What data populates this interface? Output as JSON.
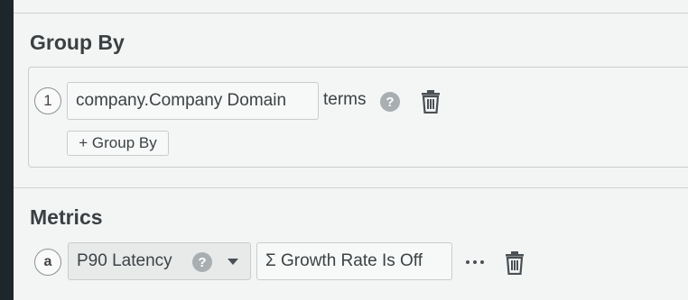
{
  "group_by": {
    "title": "Group By",
    "rows": [
      {
        "index": "1",
        "field": "company.Company Domain",
        "type_label": "terms"
      }
    ],
    "add_label": "+ Group By"
  },
  "metrics": {
    "title": "Metrics",
    "rows": [
      {
        "index": "a",
        "name": "P90 Latency",
        "growth_label": "Σ Growth Rate Is Off"
      }
    ]
  },
  "icons": {
    "help": "?",
    "trash": "trash-icon",
    "more": "more-horizontal-icon",
    "caret": "caret-down-icon"
  },
  "colors": {
    "left_rail": "#1d272b",
    "panel_bg": "#f3f4f4",
    "help_icon": "#a9aeb0"
  }
}
